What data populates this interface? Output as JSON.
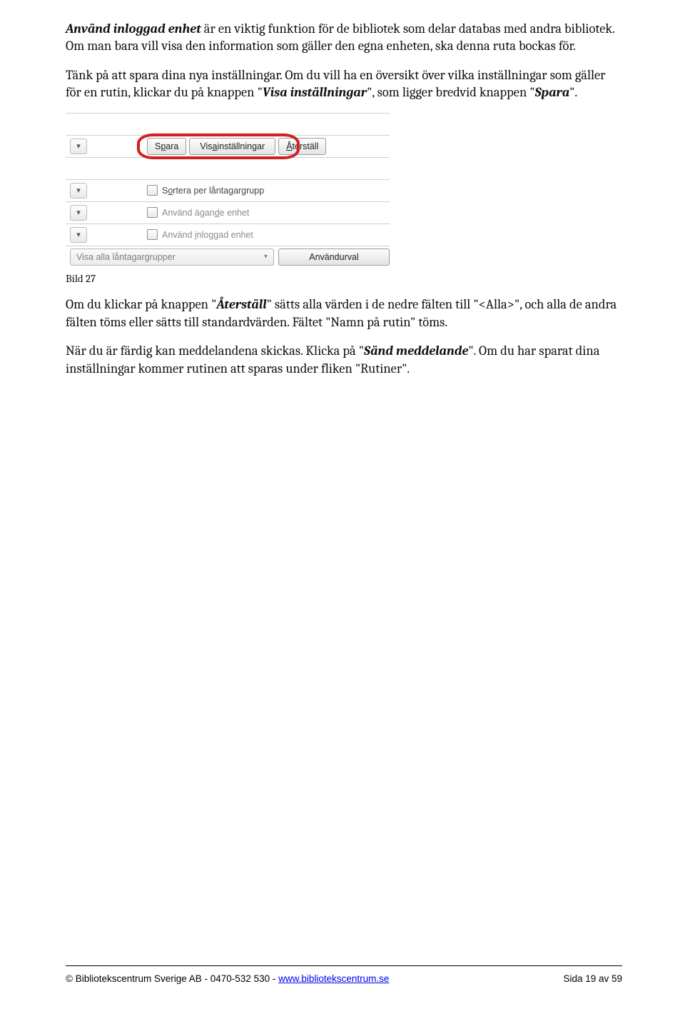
{
  "paragraphs": {
    "p1_lead_bold_italic": "Använd inloggad enhet",
    "p1_rest": " är en viktig funktion för de bibliotek som delar databas med andra bibliotek. Om man bara vill visa den information som gäller den egna enheten, ska denna ruta bockas för.",
    "p2_a": "Tänk på att spara dina nya inställningar. Om du vill ha en översikt över vilka inställningar som gäller för en rutin, klickar du på knappen \"",
    "p2_bold_italic_1": "Visa inställningar",
    "p2_b": "\", som ligger bredvid knappen \"",
    "p2_bold_italic_2": "Spara",
    "p2_c": "\".",
    "caption": "Bild 27",
    "p3_a": "Om du klickar på knappen \"",
    "p3_bold_italic": "Återställ",
    "p3_b": "\" sätts alla värden i de nedre fälten till \"<Alla>\", och alla de andra fälten töms eller sätts till standardvärden. Fältet \"Namn på rutin\" töms.",
    "p4_a": "När du är färdig kan meddelandena skickas. Klicka på \"",
    "p4_bold_italic": "Sänd meddelande",
    "p4_b": "\". Om du har sparat dina inställningar kommer rutinen att sparas under fliken \"Rutiner\"."
  },
  "screenshot": {
    "expander_glyph": "▾",
    "buttons": {
      "spara_pre": "S",
      "spara_ul": "p",
      "spara_post": "ara",
      "visa_pre": "Vis",
      "visa_ul": "a",
      "visa_post": " inställningar",
      "aterstall_pre": "",
      "aterstall_ul": "Å",
      "aterstall_post": "terställ"
    },
    "checkboxes": {
      "sortera_pre": "S",
      "sortera_ul": "o",
      "sortera_post": "rtera per låntagargrupp",
      "agande_pre": "Använd ägan",
      "agande_ul": "d",
      "agande_post": "e enhet",
      "inloggad_pre": "Använd ",
      "inloggad_ul": "i",
      "inloggad_post": "nloggad enhet"
    },
    "dropdown_label": "Visa alla låntagargrupper",
    "dropdown_caret": "▾",
    "urval_pre": "Använd ",
    "urval_ul": "u",
    "urval_post": "rval"
  },
  "footer": {
    "left_prefix": "©  Bibliotekscentrum Sverige AB - 0470-532 530 -  ",
    "link_text": "www.bibliotekscentrum.se",
    "right": "Sida 19 av 59"
  }
}
